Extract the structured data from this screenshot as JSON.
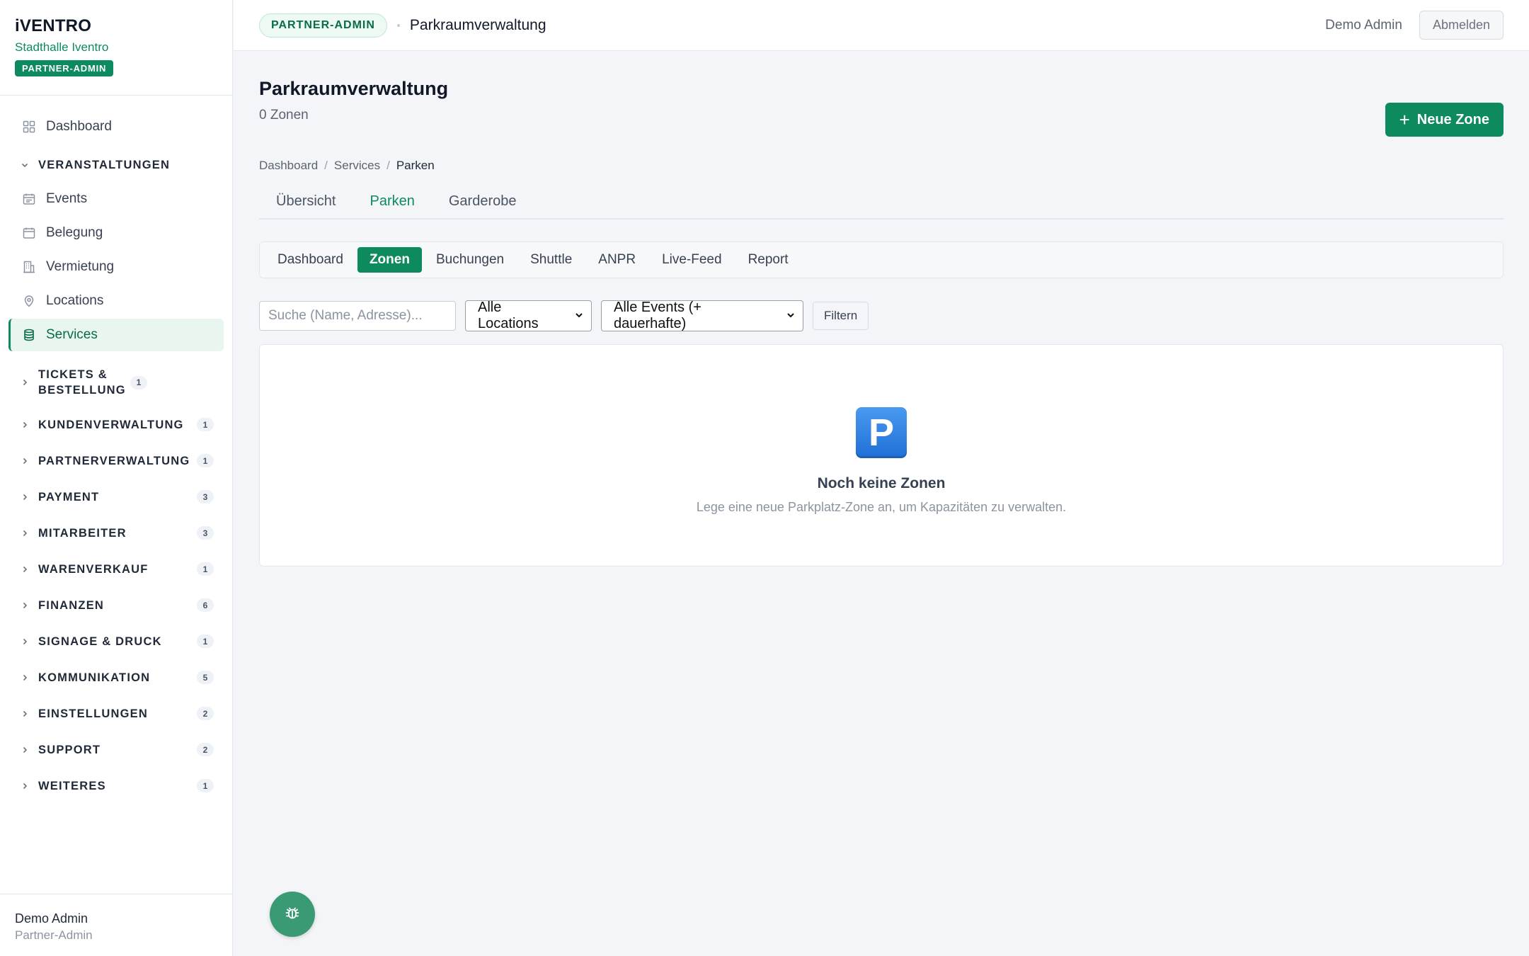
{
  "brand": {
    "logo": "iVENTRO",
    "org": "Stadthalle Iventro",
    "badge": "PARTNER-ADMIN"
  },
  "nav": {
    "dashboard": "Dashboard",
    "veranstaltungen": "VERANSTALTUNGEN",
    "events": "Events",
    "belegung": "Belegung",
    "vermietung": "Vermietung",
    "locations": "Locations",
    "services": "Services",
    "sections": [
      {
        "label": "TICKETS & BESTELLUNG",
        "count": "1"
      },
      {
        "label": "KUNDENVERWALTUNG",
        "count": "1"
      },
      {
        "label": "PARTNERVERWALTUNG",
        "count": "1"
      },
      {
        "label": "PAYMENT",
        "count": "3"
      },
      {
        "label": "MITARBEITER",
        "count": "3"
      },
      {
        "label": "WARENVERKAUF",
        "count": "1"
      },
      {
        "label": "FINANZEN",
        "count": "6"
      },
      {
        "label": "SIGNAGE & DRUCK",
        "count": "1"
      },
      {
        "label": "KOMMUNIKATION",
        "count": "5"
      },
      {
        "label": "EINSTELLUNGEN",
        "count": "2"
      },
      {
        "label": "SUPPORT",
        "count": "2"
      },
      {
        "label": "WEITERES",
        "count": "1"
      }
    ]
  },
  "footer": {
    "name": "Demo Admin",
    "role": "Partner-Admin"
  },
  "topbar": {
    "role_pill": "PARTNER-ADMIN",
    "title": "Parkraumverwaltung",
    "user": "Demo Admin",
    "logout": "Abmelden"
  },
  "page": {
    "title": "Parkraumverwaltung",
    "subtitle": "0 Zonen",
    "new_button": "Neue Zone",
    "breadcrumb": [
      "Dashboard",
      "Services",
      "Parken"
    ],
    "tabs": [
      "Übersicht",
      "Parken",
      "Garderobe"
    ],
    "subtabs": [
      "Dashboard",
      "Zonen",
      "Buchungen",
      "Shuttle",
      "ANPR",
      "Live-Feed",
      "Report"
    ]
  },
  "filters": {
    "search_placeholder": "Suche (Name, Adresse)...",
    "location_select": "Alle Locations",
    "event_select": "Alle Events (+ dauerhafte)",
    "filter_button": "Filtern"
  },
  "empty": {
    "icon_letter": "P",
    "title": "Noch keine Zonen",
    "text": "Lege eine neue Parkplatz-Zone an, um Kapazitäten zu verwalten."
  },
  "colors": {
    "accent": "#0e8a5f",
    "accent_light": "#e8f6ef",
    "background": "#f3f5f8"
  },
  "icons": {
    "dashboard": "grid-icon",
    "events": "calendar-list-icon",
    "belegung": "calendar-icon",
    "vermietung": "building-icon",
    "locations": "map-pin-icon",
    "services": "database-icon",
    "fab": "bug-icon"
  }
}
